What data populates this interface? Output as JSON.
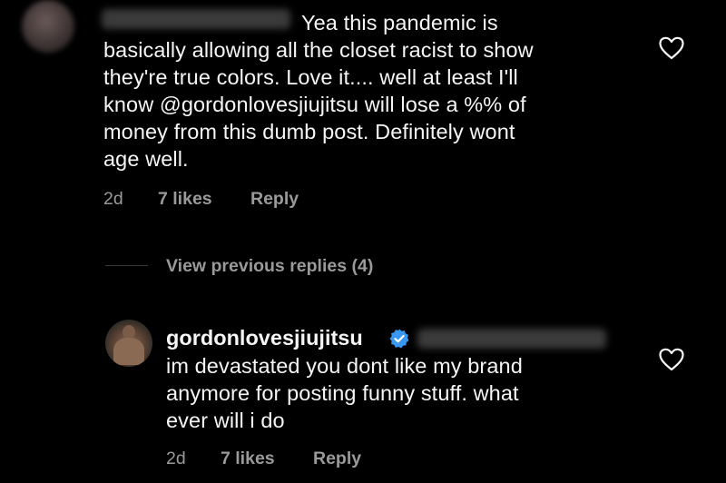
{
  "comment1": {
    "avatar_icon": "avatar-blurred",
    "text_lines": [
      "Yea this pandemic is",
      "basically allowing all the closet racist to show",
      "they're true colors. Love it.... well at least I'll",
      "know @gordonlovesjiujitsu will lose a %% of",
      "money from this dumb post.  Definitely wont",
      "age well."
    ],
    "time": "2d",
    "likes": "7 likes",
    "reply_label": "Reply",
    "like_icon": "heart-outline-icon"
  },
  "thread": {
    "view_replies_label": "View previous replies (4)"
  },
  "comment2": {
    "avatar_icon": "avatar-photo",
    "username": "gordonlovesjiujitsu",
    "verified_icon": "verified-badge-icon",
    "verified_color": "#3897f0",
    "text_lines": [
      "im devastated you dont like my brand",
      "anymore for posting funny stuff. what",
      "ever will i do"
    ],
    "time": "2d",
    "likes": "7 likes",
    "reply_label": "Reply",
    "like_icon": "heart-outline-icon"
  }
}
